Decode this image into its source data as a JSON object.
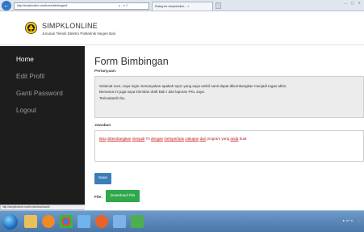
{
  "browser": {
    "address": "http://simpklonline.com/home/bimbingan3",
    "address_tools": "ρ - ✕ C",
    "tab_title": "Rating for simpklonline... ×",
    "window_controls": "— ▢ ✕"
  },
  "site": {
    "title": "SIMPKLONLINE",
    "subtitle": "Jurusan Teknik Elektro Politeknik Negeri Bali"
  },
  "sidebar": {
    "items": [
      {
        "label": "Home"
      },
      {
        "label": "Edit Profil"
      },
      {
        "label": "Ganti Password"
      },
      {
        "label": "Logout"
      }
    ]
  },
  "status_bar": {
    "url": "http://simpklonline.com/home/download/6"
  },
  "main": {
    "title": "Form Bimbingan",
    "question_label": "Pertanyaan:",
    "question_lines": [
      "Selamat sore, saya ingin menanyakan apakah topic yang saya ambil nanti dapat dikembangkan menjadi tugas akhir.",
      "Bersama ini juga saya kirimkan draft Bab I dari laporan PKL saya.",
      "Terimakasih Ibu"
    ],
    "answer_label": "Jawaban",
    "answer_words": [
      "Bisa",
      "dikembangkan",
      "menjadi",
      "TA",
      "dengan",
      "memperluas",
      "cakupan",
      "dari",
      "program",
      "yang",
      "anda",
      "buat"
    ],
    "save_label": "Save",
    "file_label": "File:",
    "download_label": "Download File"
  },
  "taskbar": {
    "tray_text": "▲ ◂ ▪ ◂ 🔈 ...",
    "icons": [
      "start-orb",
      "file-explorer-icon",
      "media-player-icon",
      "chrome-icon",
      "paint-icon",
      "browser-icon",
      "folder-icon",
      "app-icon"
    ]
  }
}
